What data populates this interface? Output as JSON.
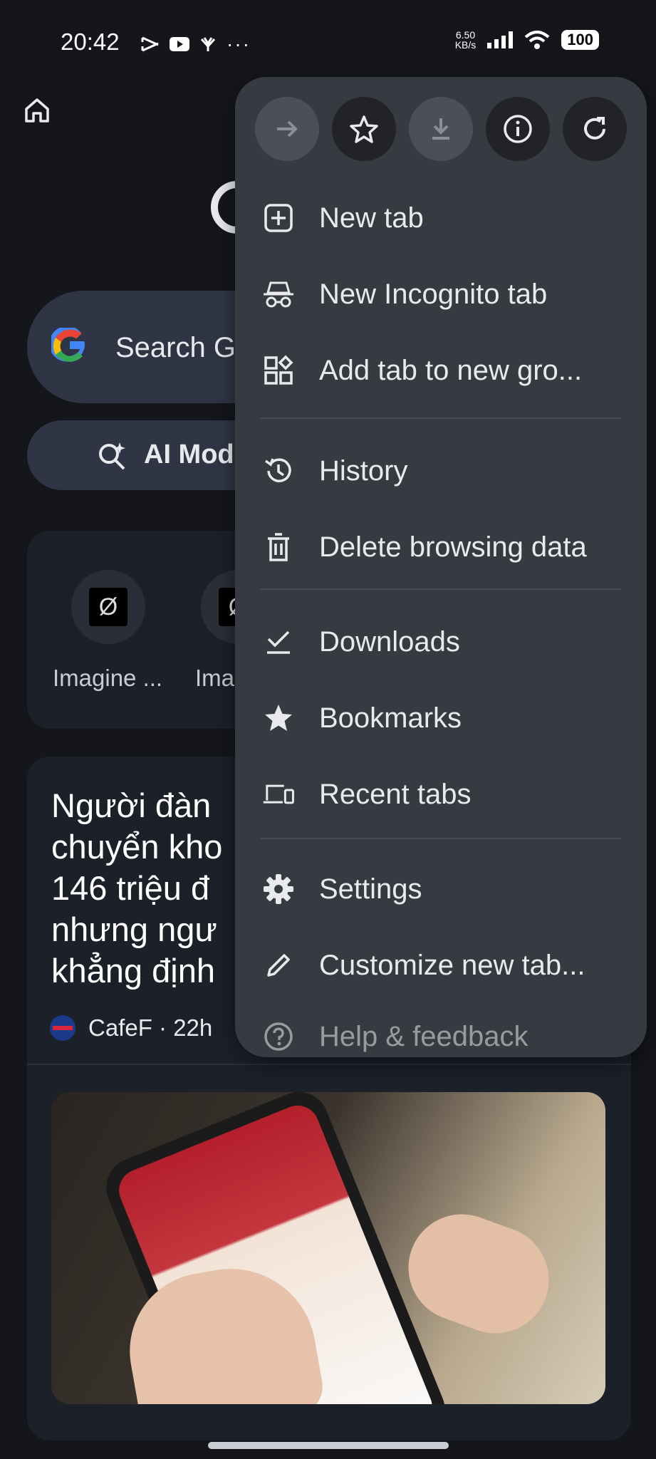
{
  "status_bar": {
    "time": "20:42",
    "net_speed_value": "6.50",
    "net_speed_unit": "KB/s",
    "battery": "100"
  },
  "background": {
    "search_placeholder": "Search G",
    "ai_mode_label": "AI Mod",
    "shortcuts": [
      {
        "label": "Imagine ...",
        "icon": "Ø"
      },
      {
        "label": "Ima",
        "icon": "Ø"
      }
    ],
    "news": {
      "headline": "Người đàn\nchuyển kho\n146 triệu đ\nnhưng ngư\nkhẳng định",
      "source": "CafeF · 22h"
    }
  },
  "menu": {
    "toolbar": [
      {
        "name": "forward-icon",
        "disabled": true
      },
      {
        "name": "star-outline-icon",
        "disabled": false
      },
      {
        "name": "download-icon",
        "disabled": true
      },
      {
        "name": "info-icon",
        "disabled": false
      },
      {
        "name": "reload-icon",
        "disabled": false
      }
    ],
    "items": [
      {
        "label": "New tab",
        "icon": "plus-box-icon"
      },
      {
        "label": "New Incognito tab",
        "icon": "incognito-icon"
      },
      {
        "label": "Add tab to new gro...",
        "icon": "tab-group-icon"
      },
      {
        "label": "History",
        "icon": "history-icon"
      },
      {
        "label": "Delete browsing data",
        "icon": "trash-icon"
      },
      {
        "label": "Downloads",
        "icon": "download-check-icon"
      },
      {
        "label": "Bookmarks",
        "icon": "star-filled-icon"
      },
      {
        "label": "Recent tabs",
        "icon": "devices-icon"
      },
      {
        "label": "Settings",
        "icon": "gear-icon"
      },
      {
        "label": "Customize new tab...",
        "icon": "pencil-icon"
      },
      {
        "label": "Help & feedback",
        "icon": "help-icon"
      }
    ]
  }
}
